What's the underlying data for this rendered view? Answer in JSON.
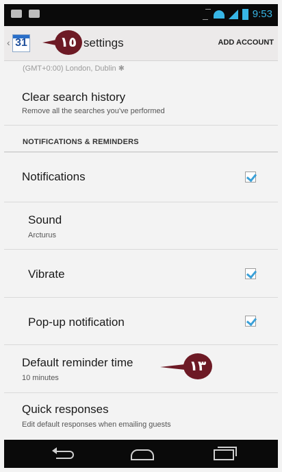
{
  "status_bar": {
    "time": "9:53"
  },
  "action_bar": {
    "calendar_day": "31",
    "title": "settings",
    "annotation": "١٥",
    "add_account": "ADD ACCOUNT"
  },
  "timezone": {
    "value": "(GMT+0:00) London, Dublin ✱"
  },
  "items": {
    "clear_history": {
      "title": "Clear search history",
      "subtitle": "Remove all the searches you've performed"
    },
    "section_header": "NOTIFICATIONS & REMINDERS",
    "notifications": {
      "title": "Notifications",
      "checked": true
    },
    "sound": {
      "title": "Sound",
      "subtitle": "Arcturus"
    },
    "vibrate": {
      "title": "Vibrate",
      "checked": true
    },
    "popup": {
      "title": "Pop-up notification",
      "checked": true
    },
    "reminder": {
      "title": "Default reminder time",
      "subtitle": "10 minutes",
      "annotation": "١٣"
    },
    "quick": {
      "title": "Quick responses",
      "subtitle": "Edit default responses when emailing guests"
    }
  },
  "icons": {
    "back": "back-arrow-icon",
    "home": "home-icon",
    "recent": "recent-apps-icon",
    "calendar": "calendar-icon"
  },
  "colors": {
    "accent": "#37b6e6",
    "annotation": "#6d1a25",
    "check": "#3aa0d8"
  }
}
